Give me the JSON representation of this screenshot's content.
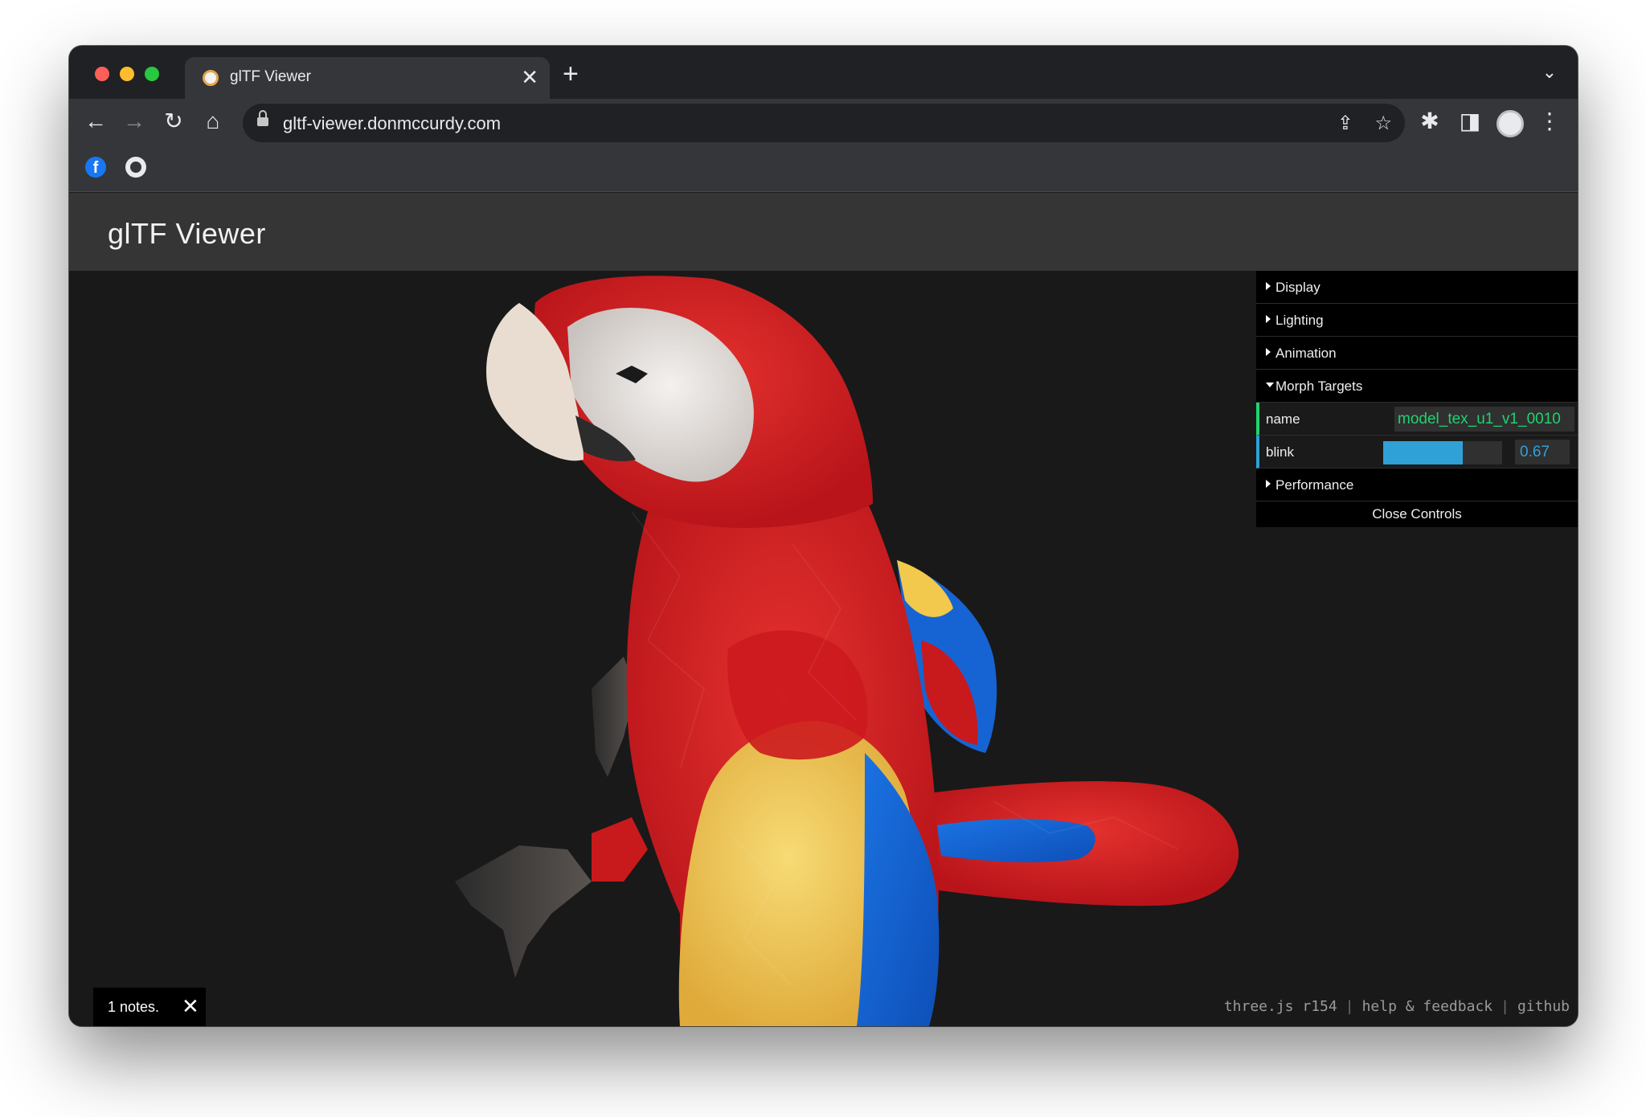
{
  "browser": {
    "tab_title": "glTF Viewer",
    "tab_close": "✕",
    "new_tab": "+",
    "tab_menu": "⌄",
    "url": "gltf-viewer.donmccurdy.com",
    "nav": {
      "back": "←",
      "forward": "→",
      "reload": "↻",
      "home": "⌂"
    },
    "omnibox_actions": {
      "share": "⇪",
      "bookmark": "☆"
    },
    "toolbar_actions": {
      "extensions": "✱",
      "side_panel": "◨",
      "menu": "⋮"
    },
    "bookmarks": [
      {
        "icon": "facebook-icon",
        "glyph": "f"
      },
      {
        "icon": "github-icon"
      }
    ]
  },
  "app": {
    "title": "glTF Viewer"
  },
  "gui": {
    "folders": {
      "display": "Display",
      "lighting": "Lighting",
      "animation": "Animation",
      "morph_targets": "Morph Targets",
      "performance": "Performance"
    },
    "morph": {
      "name_label": "name",
      "name_value": "model_tex_u1_v1_0010",
      "blink_label": "blink",
      "blink_value": "0.67",
      "blink_fraction": 0.67
    },
    "close_controls": "Close Controls"
  },
  "footer": {
    "notes": "1 notes.",
    "notes_close": "✕",
    "threejs": "three.js r154",
    "help": "help & feedback",
    "github": "github"
  },
  "colors": {
    "accent_string": "#1ed36f",
    "accent_number": "#2fa1d6",
    "parrot_red": "#d01c1f",
    "parrot_yellow": "#f2c94c",
    "parrot_blue": "#1565d8"
  }
}
